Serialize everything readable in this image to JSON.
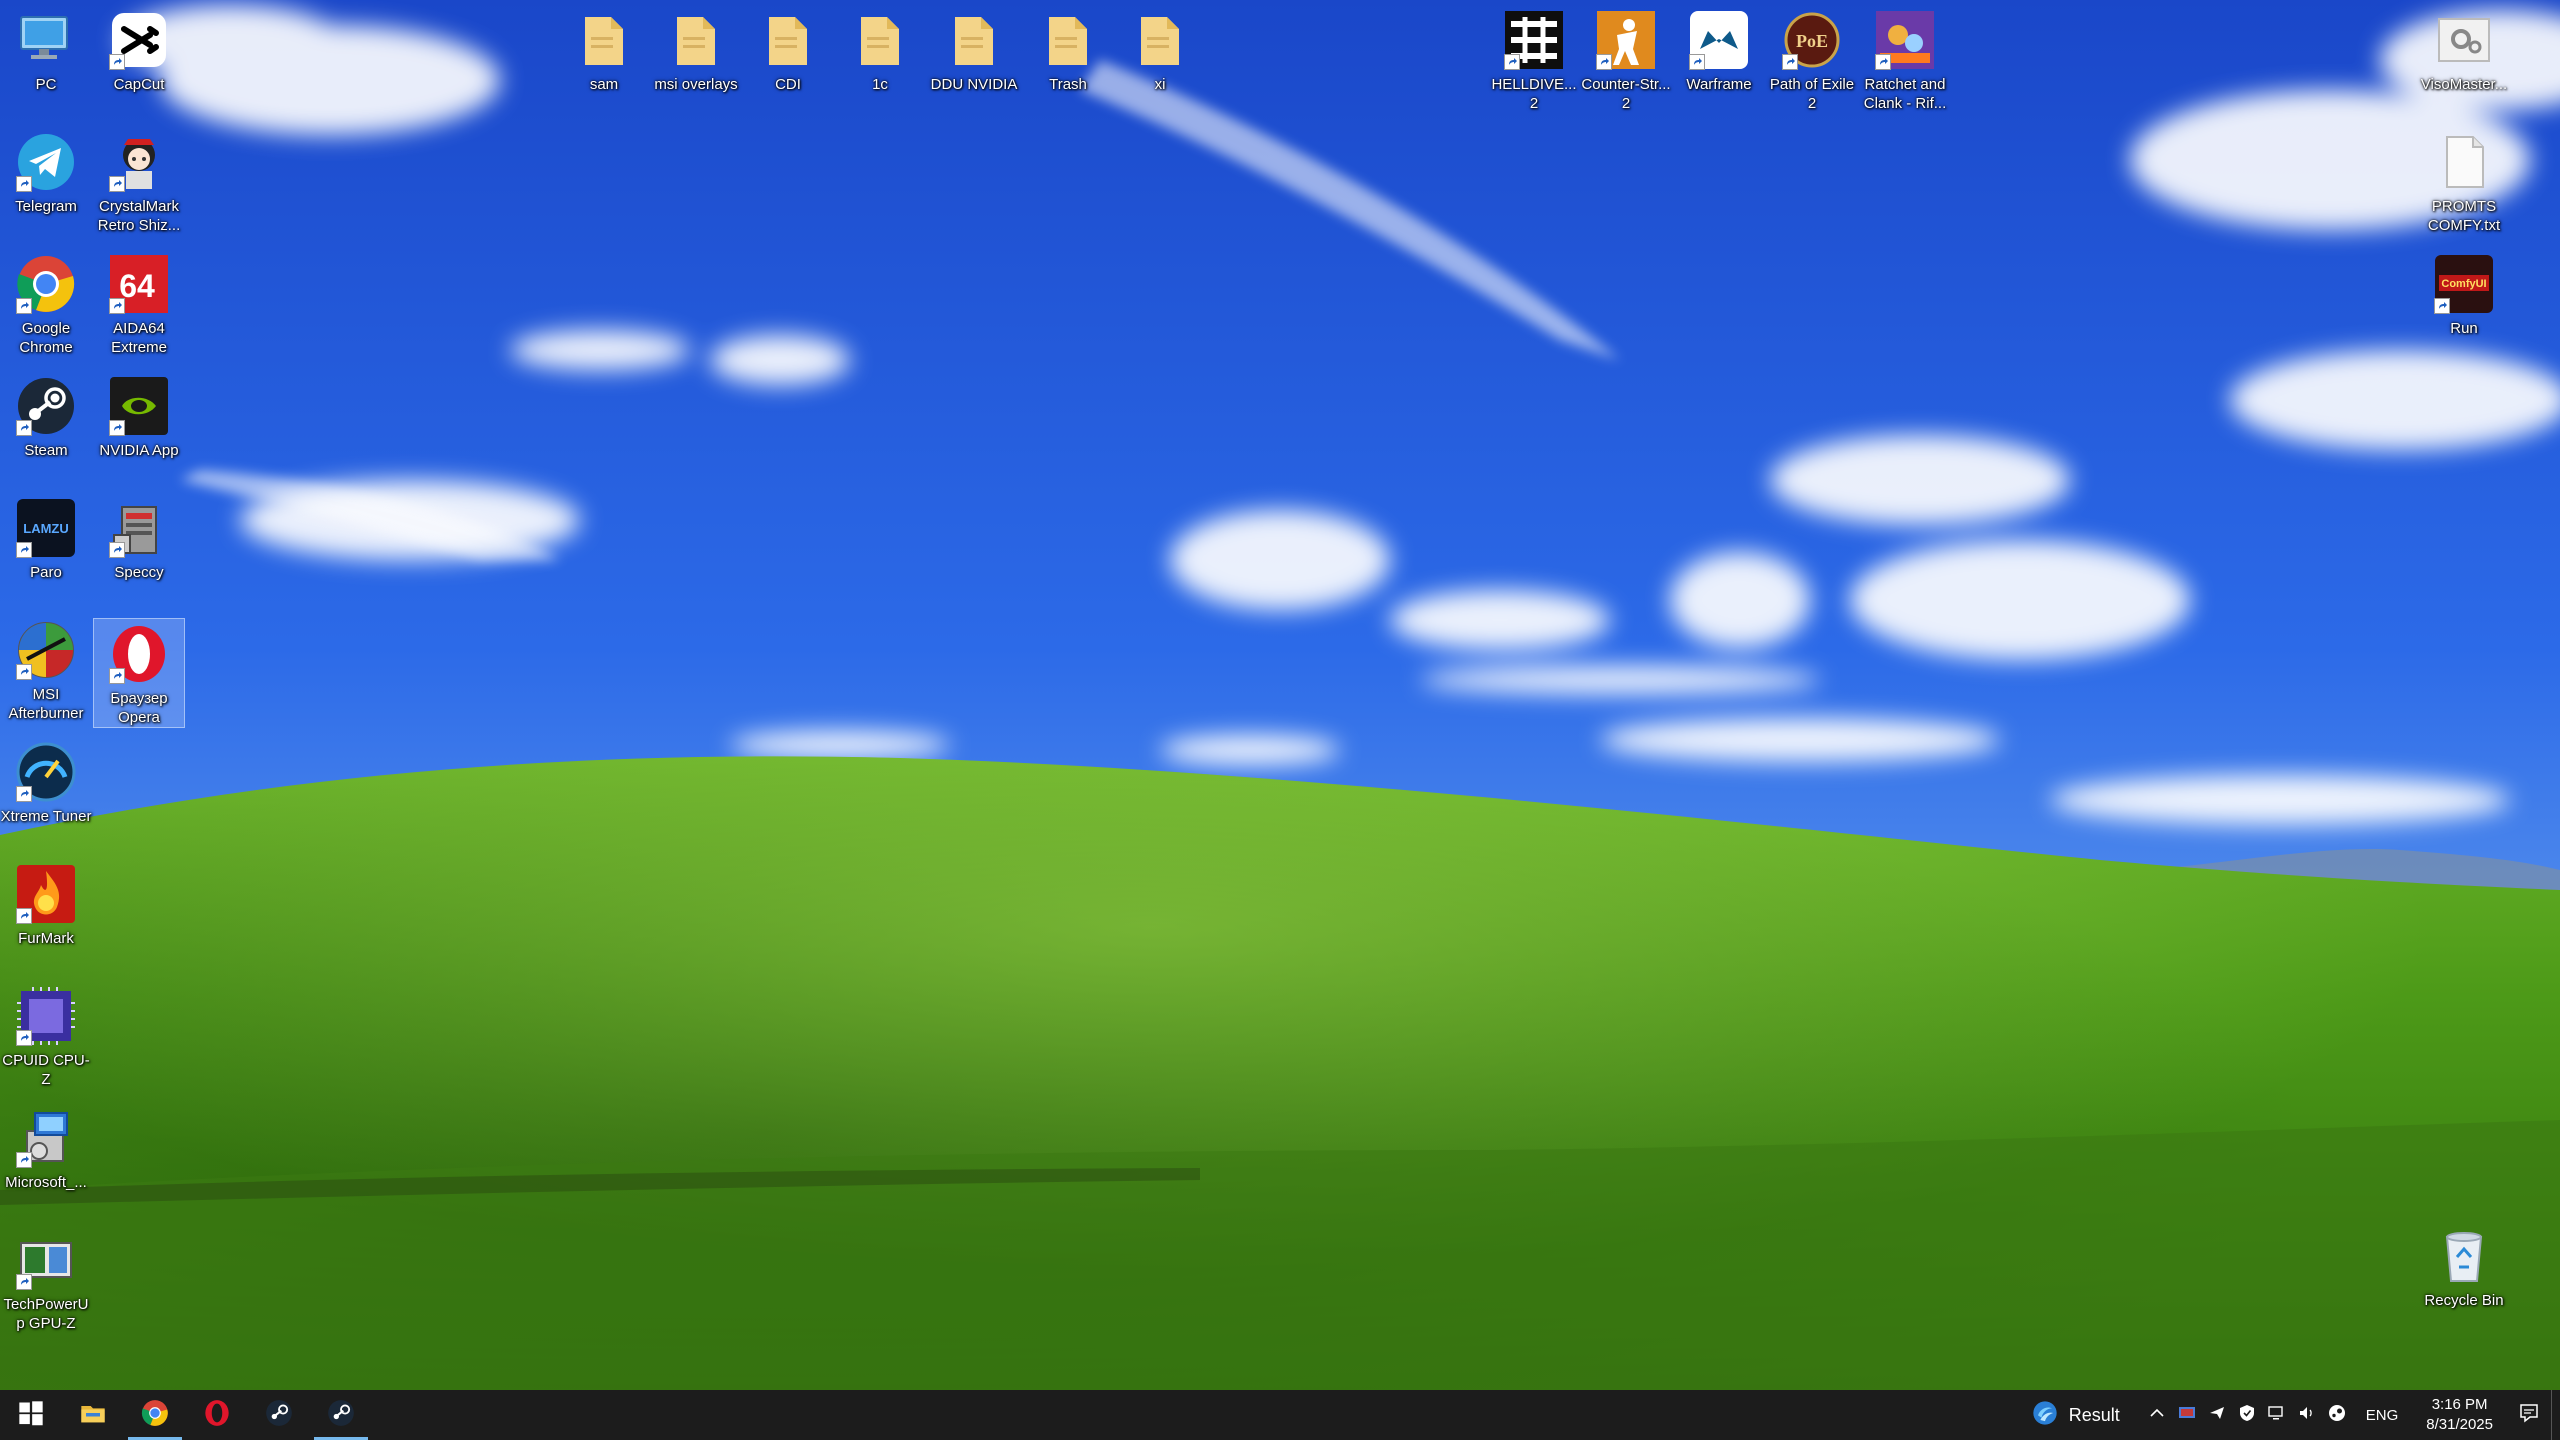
{
  "desktop": {
    "left_column_1": [
      {
        "id": "pc",
        "label": "PC",
        "icon": "computer-icon"
      },
      {
        "id": "telegram",
        "label": "Telegram",
        "icon": "telegram-icon"
      },
      {
        "id": "chrome",
        "label": "Google Chrome",
        "icon": "chrome-icon"
      },
      {
        "id": "steam",
        "label": "Steam",
        "icon": "steam-icon"
      },
      {
        "id": "paro",
        "label": "Paro",
        "icon": "paro-icon"
      },
      {
        "id": "msi-afterburner",
        "label": "MSI Afterburner",
        "icon": "afterburner-icon"
      },
      {
        "id": "xtreme-tuner",
        "label": "Xtreme Tuner",
        "icon": "xtreme-tuner-icon"
      },
      {
        "id": "furmark",
        "label": "FurMark",
        "icon": "furmark-icon"
      },
      {
        "id": "cpuz",
        "label": "CPUID CPU-Z",
        "icon": "cpuz-icon"
      },
      {
        "id": "microsoft",
        "label": "Microsoft_...",
        "icon": "installer-icon"
      },
      {
        "id": "gpuz",
        "label": "TechPowerUp GPU-Z",
        "icon": "gpuz-icon"
      }
    ],
    "left_column_2": [
      {
        "id": "capcut",
        "label": "CapCut",
        "icon": "capcut-icon"
      },
      {
        "id": "crystalmark",
        "label": "CrystalMark Retro Shiz...",
        "icon": "crystalmark-icon"
      },
      {
        "id": "aida64",
        "label": "AIDA64 Extreme",
        "icon": "aida64-icon"
      },
      {
        "id": "nvidia-app",
        "label": "NVIDIA App",
        "icon": "nvidia-icon"
      },
      {
        "id": "speccy",
        "label": "Speccy",
        "icon": "speccy-icon"
      },
      {
        "id": "opera",
        "label": "Браузер Opera",
        "icon": "opera-icon"
      }
    ],
    "top_row_folders": [
      {
        "id": "sam",
        "label": "sam",
        "icon": "folder-icon"
      },
      {
        "id": "msi-overlays",
        "label": "msi overlays",
        "icon": "folder-icon"
      },
      {
        "id": "cdi",
        "label": "CDI",
        "icon": "folder-icon"
      },
      {
        "id": "1c",
        "label": "1c",
        "icon": "folder-icon"
      },
      {
        "id": "ddu-nvidia",
        "label": "DDU NVIDIA",
        "icon": "folder-icon"
      },
      {
        "id": "trash",
        "label": "Trash",
        "icon": "folder-icon"
      },
      {
        "id": "xi",
        "label": "xi",
        "icon": "folder-icon"
      }
    ],
    "top_row_games": [
      {
        "id": "helldivers",
        "label": "HELLDIVE... 2",
        "icon": "helldivers-icon"
      },
      {
        "id": "counter-strike",
        "label": "Counter-Str... 2",
        "icon": "counter-strike-icon"
      },
      {
        "id": "warframe",
        "label": "Warframe",
        "icon": "warframe-icon"
      },
      {
        "id": "path-of-exile",
        "label": "Path of Exile 2",
        "icon": "poe-icon"
      },
      {
        "id": "ratchet",
        "label": "Ratchet and Clank - Rif...",
        "icon": "ratchet-icon"
      }
    ],
    "right_column": [
      {
        "id": "visomaster",
        "label": "VisoMaster...",
        "icon": "gear-file-icon"
      },
      {
        "id": "prompts",
        "label": "PROMTS COMFY.txt",
        "icon": "text-file-icon"
      },
      {
        "id": "run",
        "label": "Run",
        "icon": "comfyui-icon",
        "badge": "ComfyUI"
      }
    ],
    "recycle_bin": {
      "label": "Recycle Bin",
      "icon": "recycle-bin-icon"
    }
  },
  "taskbar": {
    "apps": [
      {
        "id": "start",
        "icon": "windows-start-icon"
      },
      {
        "id": "explorer",
        "icon": "file-explorer-icon"
      },
      {
        "id": "chrome",
        "icon": "chrome-icon",
        "state": "open"
      },
      {
        "id": "opera",
        "icon": "opera-icon",
        "state": ""
      },
      {
        "id": "steam",
        "icon": "steam-icon",
        "state": ""
      },
      {
        "id": "steam-2",
        "icon": "steam-icon",
        "state": "open"
      }
    ],
    "weather_label": "Result",
    "language": "ENG",
    "time": "3:16 PM",
    "date": "8/31/2025"
  },
  "colors": {
    "sky_top": "#1d4fd6",
    "sky_bottom": "#7fb2f0",
    "grass_light": "#5fae1e",
    "grass_dark": "#245e0c",
    "taskbar": "#1c1c1c",
    "accent": "#76b9ed"
  }
}
